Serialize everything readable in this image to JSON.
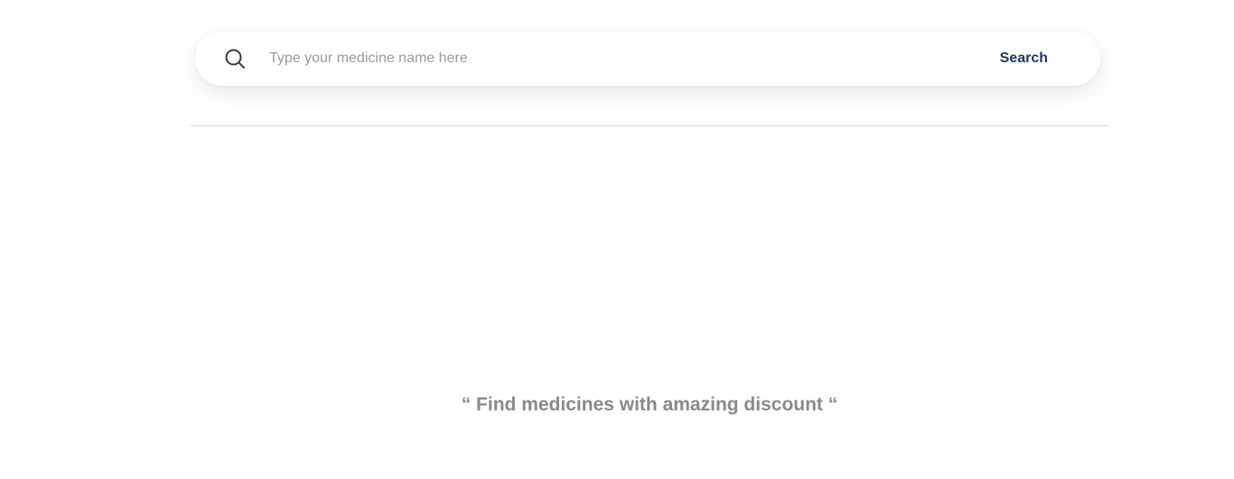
{
  "search": {
    "placeholder": "Type your medicine name here",
    "button_label": "Search",
    "icon": "search-icon"
  },
  "tagline": "“ Find medicines with amazing discount “",
  "colors": {
    "button_text": "#1f3b63",
    "tagline_text": "#8a8a8a",
    "placeholder_text": "#9a9a9a",
    "divider": "#d6d6d6"
  }
}
